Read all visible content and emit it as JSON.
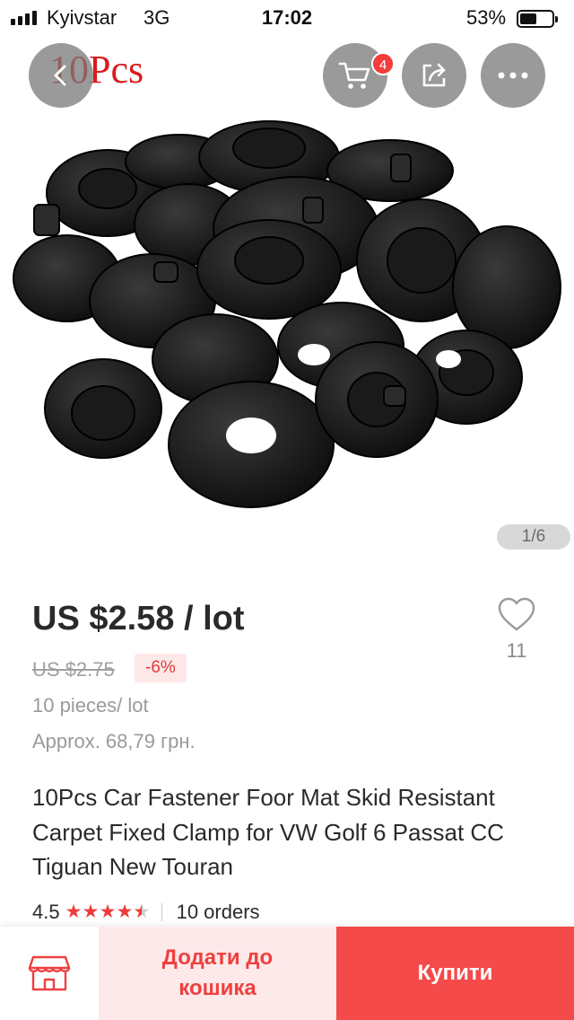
{
  "status_bar": {
    "carrier": "Kyivstar",
    "network": "3G",
    "time": "17:02",
    "battery": "53%",
    "battery_level": 0.53
  },
  "header": {
    "back_icon": "chevron-left-icon",
    "cart_icon": "cart-icon",
    "cart_badge": "4",
    "share_icon": "share-icon",
    "more_icon": "more-dots-icon"
  },
  "gallery": {
    "watermark": "10Pcs",
    "pager": "1/6"
  },
  "product": {
    "price": "US $2.58 / lot",
    "old_price": "US $2.75",
    "discount": "-6%",
    "lot_info": "10 pieces/ lot",
    "approx_price": "Approx. 68,79 грн.",
    "title": "10Pcs Car Fastener Foor Mat Skid Resistant Carpet Fixed Clamp for VW Golf 6 Passat CC Tiguan New Touran",
    "rating": "4.5",
    "rating_value": 4.5,
    "orders": "10 orders",
    "wishlist_count": "11"
  },
  "bottom_bar": {
    "store_icon": "store-icon",
    "add_to_cart": "Додати до кошика",
    "buy": "Купити"
  },
  "colors": {
    "accent": "#f44a4a",
    "accent_light": "#fde9e9",
    "price_text": "#2a2a2a",
    "muted_text": "#9a9a9a",
    "watermark": "#d81c1c"
  }
}
